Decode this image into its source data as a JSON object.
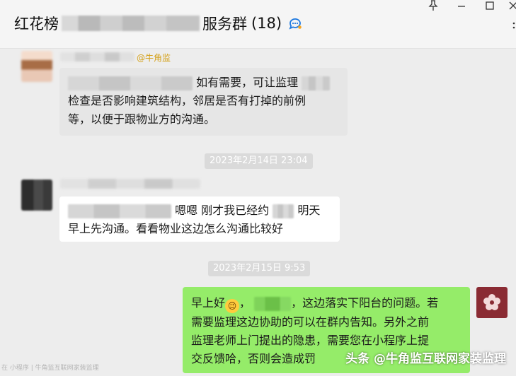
{
  "header": {
    "title_prefix": "红花榜",
    "title_suffix": "服务群",
    "member_count": "(18)",
    "pin_icon": "pin-icon",
    "minimize_icon": "minimize-icon",
    "maximize_icon": "maximize-icon",
    "close_icon": "close-icon",
    "more_icon": "more-icon"
  },
  "messages": [
    {
      "mention": "@牛角监",
      "lines": [
        "如有需要，可让监理",
        "检查是否影响建筑结构，邻居是否有打掉的前例",
        "等，以便于跟物业方的沟通。"
      ]
    },
    {
      "timestamp": "2023年2月14日 23:04"
    },
    {
      "lines": [
        "嗯嗯 刚才我已经约",
        "明天",
        "早上先沟通。看看物业这边怎么沟通比较好"
      ]
    },
    {
      "timestamp": "2023年2月15日 9:53"
    },
    {
      "lines": [
        "早上好",
        "，",
        "，这边落实下阳台的问题。若",
        "需要监理这边协助的可以在群内告知。另外之前",
        "监理老师上门提出的隐患，需要您在小程序上提",
        "交反馈哈，否则会造成罚"
      ]
    }
  ],
  "watermark": {
    "left": "在 小程序 | 牛角监互联网家装监理",
    "right": "头条 @牛角监互联网家装监理"
  },
  "colors": {
    "bubble_green": "#95ec69",
    "bubble_gray": "#e6e6e6",
    "background": "#ededed",
    "mention": "#d4a017"
  }
}
